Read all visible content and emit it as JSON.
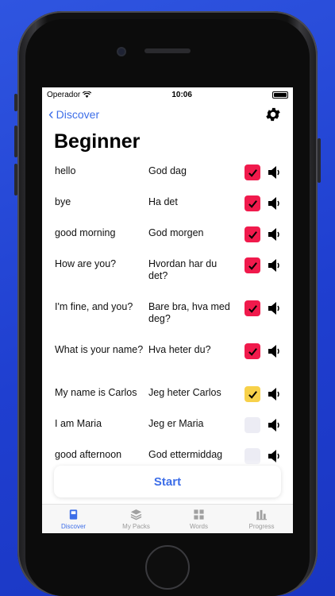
{
  "status": {
    "carrier": "Operador",
    "time": "10:06"
  },
  "nav": {
    "back_label": "Discover"
  },
  "page": {
    "title": "Beginner"
  },
  "rows": [
    {
      "english": "hello",
      "norwegian": "God dag",
      "state": "red"
    },
    {
      "english": "bye",
      "norwegian": "Ha det",
      "state": "red"
    },
    {
      "english": "good morning",
      "norwegian": "God morgen",
      "state": "red"
    },
    {
      "english": "How are you?",
      "norwegian": "Hvordan har du det?",
      "state": "red"
    },
    {
      "english": "I'm fine, and you?",
      "norwegian": "Bare bra, hva med deg?",
      "state": "red"
    },
    {
      "english": "What is your name?",
      "norwegian": "Hva heter du?",
      "state": "red"
    },
    {
      "english": "My name is Carlos",
      "norwegian": "Jeg heter Carlos",
      "state": "yellow"
    },
    {
      "english": "I am Maria",
      "norwegian": "Jeg er Maria",
      "state": "empty"
    },
    {
      "english": "good afternoon",
      "norwegian": "God ettermiddag",
      "state": "empty"
    }
  ],
  "start_button": {
    "label": "Start"
  },
  "tabs": [
    {
      "label": "Discover",
      "icon": "book-icon",
      "active": true
    },
    {
      "label": "My Packs",
      "icon": "layers-icon",
      "active": false
    },
    {
      "label": "Words",
      "icon": "grid-icon",
      "active": false
    },
    {
      "label": "Progress",
      "icon": "chart-icon",
      "active": false
    }
  ],
  "colors": {
    "accent": "#3d6ee8",
    "checked_red": "#f01a4c",
    "checked_yellow": "#f7d14a",
    "background": "#2346d8"
  }
}
